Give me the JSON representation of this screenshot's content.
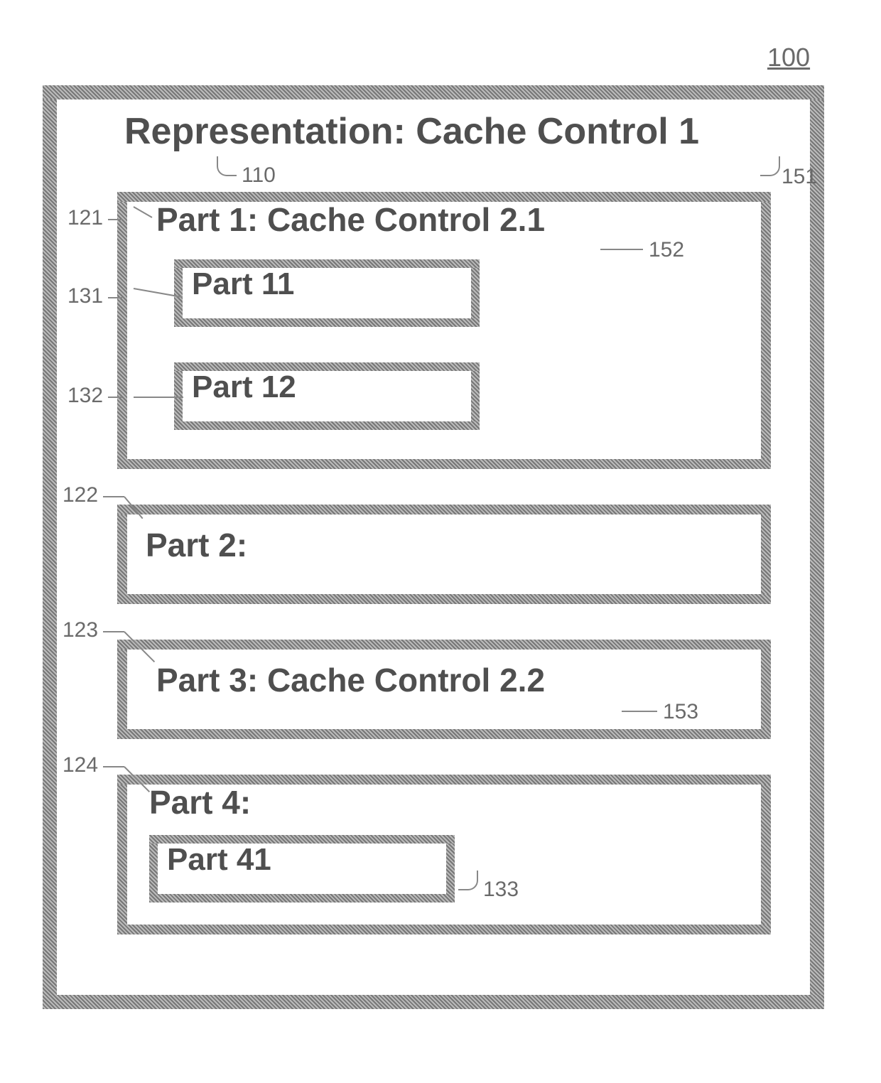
{
  "figure_ref": "100",
  "outer": {
    "title": "Representation: Cache Control 1",
    "ref_title": "110",
    "ref_box": "151",
    "parts": {
      "part1": {
        "title": "Part 1: Cache Control 2.1",
        "ref_box": "121",
        "ref_cc": "152",
        "children": {
          "part11": {
            "title": "Part 11",
            "ref": "131"
          },
          "part12": {
            "title": "Part 12",
            "ref": "132"
          }
        }
      },
      "part2": {
        "title": "Part 2:",
        "ref": "122"
      },
      "part3": {
        "title": "Part 3: Cache Control 2.2",
        "ref": "123",
        "ref_cc": "153"
      },
      "part4": {
        "title": "Part 4:",
        "ref": "124",
        "children": {
          "part41": {
            "title": "Part 41",
            "ref": "133"
          }
        }
      }
    }
  }
}
